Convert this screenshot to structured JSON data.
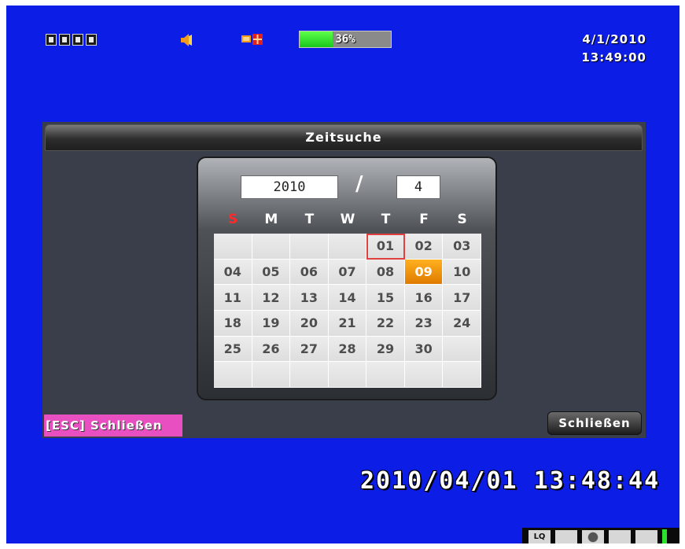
{
  "status": {
    "hdd_percent_label": "36%",
    "hdd_fill_fraction": 0.36,
    "date": "4/1/2010",
    "time": "13:49:00",
    "icons": [
      "camera-channel-icon",
      "camera-channel-icon",
      "camera-channel-icon",
      "camera-channel-icon",
      "speaker-icon",
      "network-icon"
    ]
  },
  "dialog": {
    "title": "Zeitsuche",
    "year": "2010",
    "separator": "/",
    "month": "4",
    "weekdays": [
      "S",
      "M",
      "T",
      "W",
      "T",
      "F",
      "S"
    ],
    "days": [
      "",
      "",
      "",
      "",
      "01",
      "02",
      "03",
      "04",
      "05",
      "06",
      "07",
      "08",
      "09",
      "10",
      "11",
      "12",
      "13",
      "14",
      "15",
      "16",
      "17",
      "18",
      "19",
      "20",
      "21",
      "22",
      "23",
      "24",
      "25",
      "26",
      "27",
      "28",
      "29",
      "30",
      "",
      "",
      "",
      "",
      "",
      "",
      "",
      ""
    ],
    "today": "01",
    "selected": "09",
    "close_button": "Schließen"
  },
  "esc_hint": "[ESC] Schließen",
  "osd_datetime": "2010/04/01 13:48:44",
  "toolbar": {
    "lq_label": "LQ"
  },
  "colors": {
    "screen_bg": "#0c1de6",
    "selected_day": "#f08c00",
    "sunday": "#ff2a2a",
    "esc_label_bg": "#e84fc0"
  }
}
